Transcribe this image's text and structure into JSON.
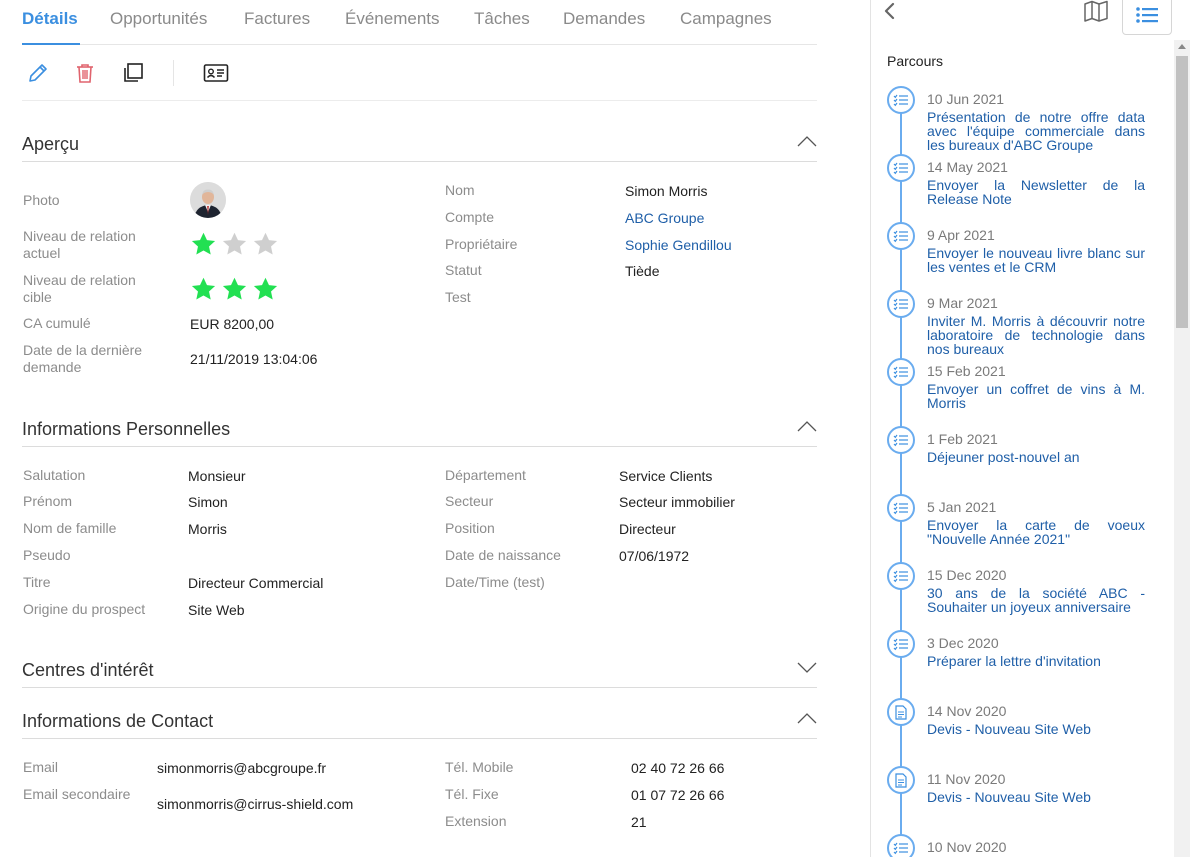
{
  "tabs": [
    "Détails",
    "Opportunités",
    "Factures",
    "Événements",
    "Tâches",
    "Demandes",
    "Campagnes"
  ],
  "sections": {
    "apercu": "Aperçu",
    "perso": "Informations Personnelles",
    "interets": "Centres d'intérêt",
    "contact": "Informations de Contact"
  },
  "apercu": {
    "photo_label": "Photo",
    "niveau_actuel_label": "Niveau de relation actuel",
    "niveau_actuel_value": 1,
    "niveau_cible_label": "Niveau de relation cible",
    "niveau_cible_value": 3,
    "stars_max": 3,
    "ca_label": "CA cumulé",
    "ca_value": "EUR 8200,00",
    "derniere_demande_label": "Date de la dernière demande",
    "derniere_demande_value": "21/11/2019 13:04:06",
    "nom_label": "Nom",
    "nom_value": "Simon Morris",
    "compte_label": "Compte",
    "compte_value": "ABC Groupe",
    "proprietaire_label": "Propriétaire",
    "proprietaire_value": "Sophie Gendillou",
    "statut_label": "Statut",
    "statut_value": "Tiède",
    "test_label": "Test"
  },
  "perso": {
    "salutation_label": "Salutation",
    "salutation_value": "Monsieur",
    "prenom_label": "Prénom",
    "prenom_value": "Simon",
    "nom_famille_label": "Nom de famille",
    "nom_famille_value": "Morris",
    "pseudo_label": "Pseudo",
    "titre_label": "Titre",
    "titre_value": "Directeur Commercial",
    "origine_label": "Origine du prospect",
    "origine_value": "Site Web",
    "departement_label": "Département",
    "departement_value": "Service Clients",
    "secteur_label": "Secteur",
    "secteur_value": "Secteur immobilier",
    "position_label": "Position",
    "position_value": "Directeur",
    "naissance_label": "Date de naissance",
    "naissance_value": "07/06/1972",
    "datetime_label": "Date/Time (test)"
  },
  "contact": {
    "email_label": "Email",
    "email_value": "simonmorris@abcgroupe.fr",
    "email2_label": "Email secondaire",
    "email2_value": "simonmorris@cirrus-shield.com",
    "mobile_label": "Tél. Mobile",
    "mobile_value": "02 40 72 26 66",
    "fixe_label": "Tél. Fixe",
    "fixe_value": "01 07 72 26 66",
    "extension_label": "Extension",
    "extension_value": "21"
  },
  "parcours": {
    "title": "Parcours",
    "items": [
      {
        "date": "10 Jun 2021",
        "text": "Présentation de notre offre data avec l'équipe commerciale dans les bureaux d'ABC Groupe",
        "icon": "task-list-icon"
      },
      {
        "date": "14 May 2021",
        "text": "Envoyer la Newsletter de la Release Note",
        "icon": "task-list-icon"
      },
      {
        "date": "9 Apr 2021",
        "text": "Envoyer le nouveau livre blanc sur les ventes et le CRM",
        "icon": "task-list-icon"
      },
      {
        "date": "9 Mar 2021",
        "text": "Inviter M. Morris à découvrir notre laboratoire de technologie dans nos bureaux",
        "icon": "task-list-icon"
      },
      {
        "date": "15 Feb 2021",
        "text": "Envoyer un coffret de vins à M. Morris",
        "icon": "task-list-icon"
      },
      {
        "date": "1 Feb 2021",
        "text": "Déjeuner post-nouvel an",
        "icon": "task-list-icon"
      },
      {
        "date": "5 Jan 2021",
        "text": "Envoyer la carte de voeux \"Nouvelle Année 2021\"",
        "icon": "task-list-icon"
      },
      {
        "date": "15 Dec 2020",
        "text": "30 ans de la société ABC - Souhaiter un joyeux anniversaire",
        "icon": "task-list-icon"
      },
      {
        "date": "3 Dec 2020",
        "text": "Préparer la lettre d'invitation",
        "icon": "task-list-icon"
      },
      {
        "date": "14 Nov 2020",
        "text": "Devis - Nouveau Site Web",
        "icon": "document-icon"
      },
      {
        "date": "11 Nov 2020",
        "text": "Devis - Nouveau Site Web",
        "icon": "document-icon"
      },
      {
        "date": "10 Nov 2020",
        "text": "",
        "icon": "task-list-icon"
      }
    ]
  },
  "colors": {
    "accent": "#3b8fe0",
    "star_on": "#22e052",
    "star_off": "#cfcfcf",
    "link": "#1f5fa8",
    "delete": "#e0646e"
  }
}
